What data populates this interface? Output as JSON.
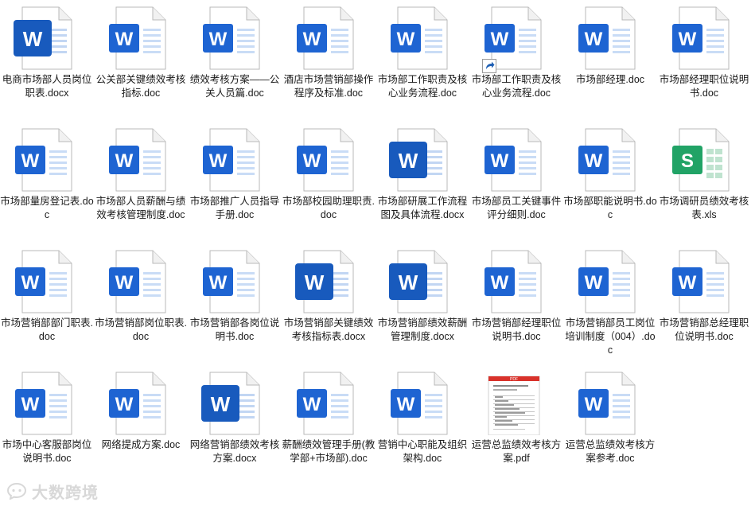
{
  "colors": {
    "word_blue": "#1e64d2",
    "word_dark_blue": "#185abd",
    "excel_green": "#21a366",
    "pdf_red": "#d9322b",
    "label_text": "#1a1a1a",
    "background": "#ffffff"
  },
  "files": [
    {
      "name": "电商市场部人员岗位职表.docx",
      "type": "word-new"
    },
    {
      "name": "公关部关键绩效考核指标.doc",
      "type": "word"
    },
    {
      "name": "绩效考核方案——公关人员篇.doc",
      "type": "word"
    },
    {
      "name": "酒店市场营销部操作程序及标准.doc",
      "type": "word"
    },
    {
      "name": "市场部工作职责及核心业务流程.doc",
      "type": "word"
    },
    {
      "name": "市场部工作职责及核心业务流程.doc",
      "type": "word-shortcut"
    },
    {
      "name": "市场部经理.doc",
      "type": "word"
    },
    {
      "name": "市场部经理职位说明书.doc",
      "type": "word"
    },
    {
      "name": "市场部量房登记表.doc",
      "type": "word"
    },
    {
      "name": "市场部人员薪酬与绩效考核管理制度.doc",
      "type": "word"
    },
    {
      "name": "市场部推广人员指导手册.doc",
      "type": "word"
    },
    {
      "name": "市场部校园助理职责.doc",
      "type": "word"
    },
    {
      "name": "市场部研展工作流程图及具体流程.docx",
      "type": "word-new"
    },
    {
      "name": "市场部员工关键事件评分细则.doc",
      "type": "word"
    },
    {
      "name": "市场部职能说明书.doc",
      "type": "word"
    },
    {
      "name": "市场调研员绩效考核表.xls",
      "type": "excel"
    },
    {
      "name": "市场营销部部门职表.doc",
      "type": "word"
    },
    {
      "name": "市场营销部岗位职表.doc",
      "type": "word"
    },
    {
      "name": "市场营销部各岗位说明书.doc",
      "type": "word"
    },
    {
      "name": "市场营销部关键绩效考核指标表.docx",
      "type": "word-new"
    },
    {
      "name": "市场营销部绩效薪酬管理制度.docx",
      "type": "word-new"
    },
    {
      "name": "市场营销部经理职位说明书.doc",
      "type": "word"
    },
    {
      "name": "市场营销部员工岗位培训制度（004）.doc",
      "type": "word"
    },
    {
      "name": "市场营销部总经理职位说明书.doc",
      "type": "word"
    },
    {
      "name": "市场中心客服部岗位说明书.doc",
      "type": "word"
    },
    {
      "name": "网络提成方案.doc",
      "type": "word"
    },
    {
      "name": "网络营销部绩效考核方案.docx",
      "type": "word-new"
    },
    {
      "name": "薪酬绩效管理手册(教学部+市场部).doc",
      "type": "word"
    },
    {
      "name": "营销中心职能及组织架构.doc",
      "type": "word"
    },
    {
      "name": "运营总监绩效考核方案.pdf",
      "type": "pdf"
    },
    {
      "name": "运营总监绩效考核方案参考.doc",
      "type": "word"
    }
  ],
  "icon_glyphs": {
    "word": "W",
    "excel": "S",
    "pdf_banner": "PDF"
  },
  "watermark": {
    "text": "大数跨境",
    "icon": "chat-bubble-logo-icon"
  }
}
